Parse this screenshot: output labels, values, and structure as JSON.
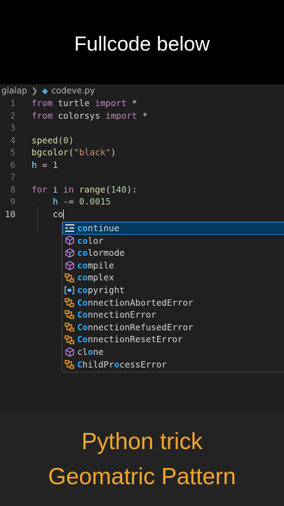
{
  "banner": {
    "caption": "Fullcode below"
  },
  "breadcrumb": {
    "folder": "gialap",
    "file": "codeve.py"
  },
  "code_lines": [
    {
      "n": "1"
    },
    {
      "n": "2"
    },
    {
      "n": "3"
    },
    {
      "n": "4"
    },
    {
      "n": "5"
    },
    {
      "n": "6"
    },
    {
      "n": "7"
    },
    {
      "n": "8"
    },
    {
      "n": "9"
    },
    {
      "n": "10"
    }
  ],
  "code": {
    "l1": [
      "from",
      " turtle ",
      "import",
      " *"
    ],
    "l2": [
      "from",
      " colorsys ",
      "import",
      " *"
    ],
    "l4": [
      "speed",
      "(",
      "0",
      ")"
    ],
    "l5": [
      "bgcolor",
      "(",
      "\"black\"",
      ")"
    ],
    "l6": [
      "h",
      " = ",
      "1"
    ],
    "l8": [
      "for",
      " ",
      "i",
      " ",
      "in",
      " ",
      "range",
      "(",
      "140",
      "):"
    ],
    "l9": [
      "h",
      " -= ",
      "0.0015"
    ],
    "l10": "co"
  },
  "suggestions": [
    {
      "pre": "",
      "hl": "co",
      "post": "ntinue",
      "icon": "keyword-icon"
    },
    {
      "pre": "",
      "hl": "co",
      "post": "lor",
      "icon": "method-icon"
    },
    {
      "pre": "",
      "hl": "co",
      "post": "lormode",
      "icon": "method-icon"
    },
    {
      "pre": "",
      "hl": "co",
      "post": "mpile",
      "icon": "method-icon"
    },
    {
      "pre": "",
      "hl": "co",
      "post": "mplex",
      "icon": "class-icon"
    },
    {
      "pre": "",
      "hl": "co",
      "post": "pyright",
      "icon": "variable-icon"
    },
    {
      "pre": "",
      "hl": "Co",
      "post": "nnectionAbortedError",
      "icon": "class-icon"
    },
    {
      "pre": "",
      "hl": "Co",
      "post": "nnectionError",
      "icon": "class-icon"
    },
    {
      "pre": "",
      "hl": "Co",
      "post": "nnectionRefusedError",
      "icon": "class-icon"
    },
    {
      "pre": "",
      "hl": "Co",
      "post": "nnectionResetError",
      "icon": "class-icon"
    },
    {
      "pre": "cl",
      "hl": "o",
      "post": "ne",
      "icon": "method-icon"
    },
    {
      "pre": "",
      "hl": "C",
      "post": "hildPr",
      "hl2": "o",
      "post2": "cessError",
      "icon": "class-icon"
    }
  ],
  "bottom": {
    "line1": "Python trick",
    "line2": "Geomatric Pattern"
  },
  "colors": {
    "accent_orange": "#f2a72e",
    "match_blue": "#2aaaff",
    "selection": "#04395e",
    "keyword": "#c586c0",
    "method_icon": "#b180d7",
    "class_icon": "#ee9d28"
  }
}
